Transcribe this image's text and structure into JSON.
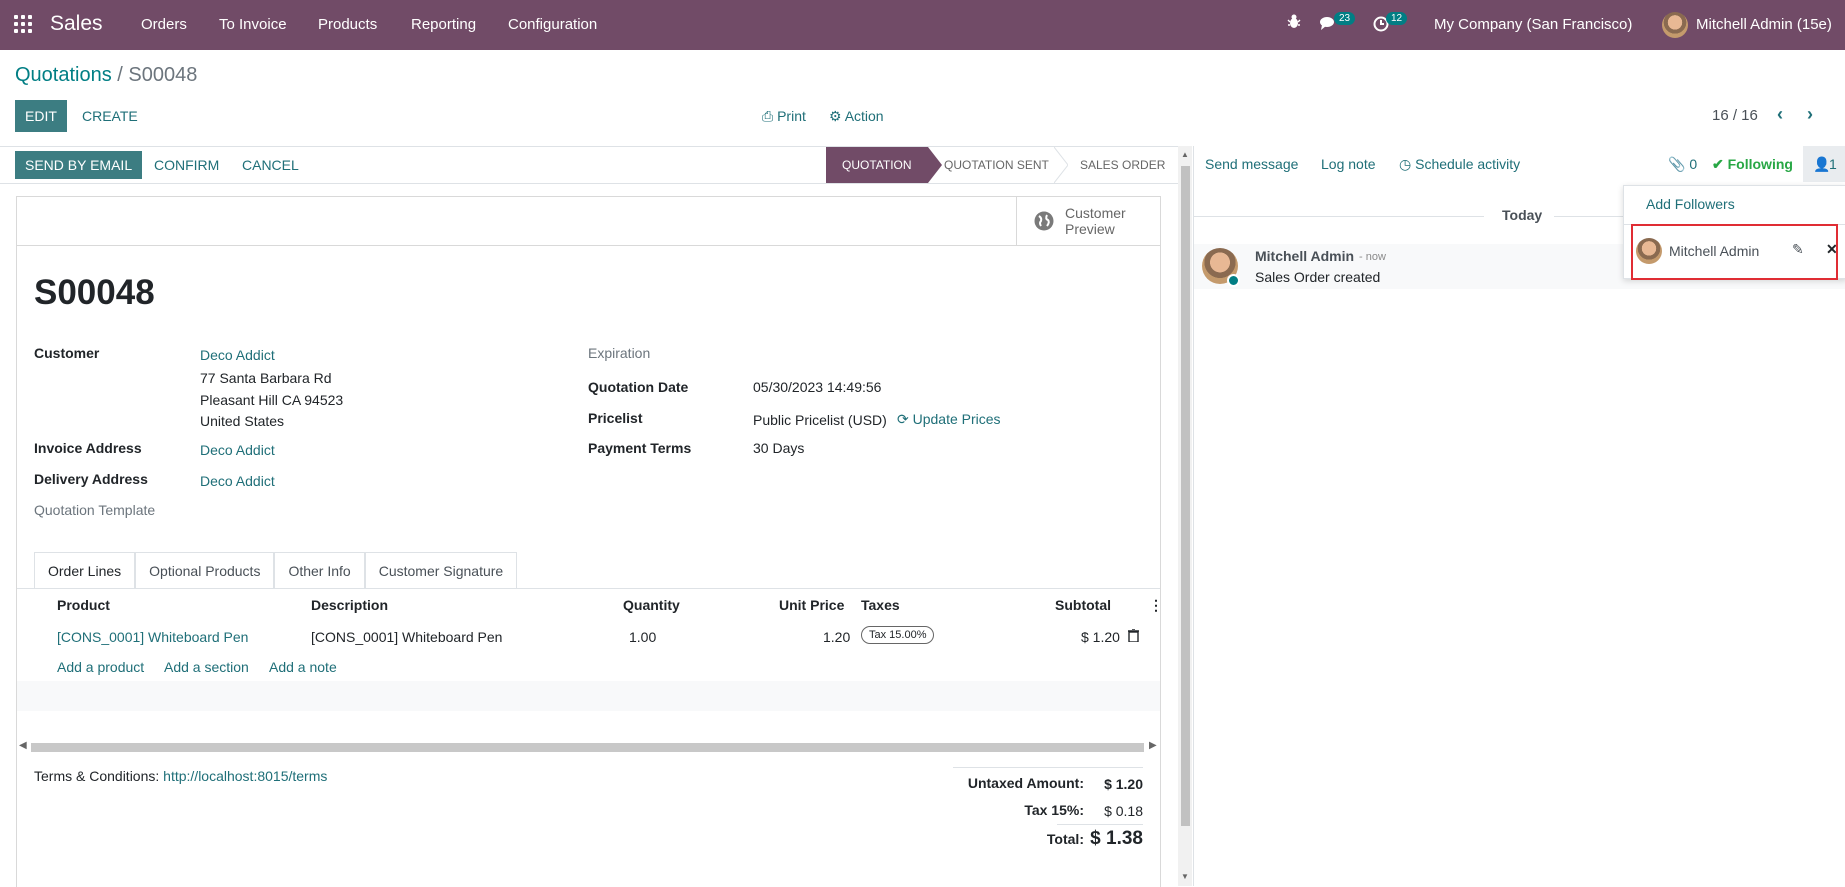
{
  "navbar": {
    "app_name": "Sales",
    "menu": [
      "Orders",
      "To Invoice",
      "Products",
      "Reporting",
      "Configuration"
    ],
    "messages_count": "23",
    "activities_count": "12",
    "company": "My Company (San Francisco)",
    "user": "Mitchell Admin (15e)"
  },
  "breadcrumb": {
    "parent": "Quotations",
    "separator": "/",
    "current": "S00048"
  },
  "controls": {
    "edit": "EDIT",
    "create": "CREATE",
    "print": "Print",
    "action": "Action",
    "pager": "16 / 16"
  },
  "statusbar": {
    "send_email": "SEND BY EMAIL",
    "confirm": "CONFIRM",
    "cancel": "CANCEL",
    "stages": [
      "QUOTATION",
      "QUOTATION SENT",
      "SALES ORDER"
    ]
  },
  "form": {
    "customer_preview": [
      "Customer",
      "Preview"
    ],
    "name": "S00048",
    "customer_label": "Customer",
    "customer_name": "Deco Addict",
    "customer_address": [
      "77 Santa Barbara Rd",
      "Pleasant Hill CA 94523",
      "United States"
    ],
    "invoice_address_label": "Invoice Address",
    "invoice_address": "Deco Addict",
    "delivery_address_label": "Delivery Address",
    "delivery_address": "Deco Addict",
    "quotation_template_label": "Quotation Template",
    "expiration_label": "Expiration",
    "quotation_date_label": "Quotation Date",
    "quotation_date": "05/30/2023 14:49:56",
    "pricelist_label": "Pricelist",
    "pricelist": "Public Pricelist (USD)",
    "update_prices": "Update Prices",
    "payment_terms_label": "Payment Terms",
    "payment_terms": "30 Days"
  },
  "tabs": [
    "Order Lines",
    "Optional Products",
    "Other Info",
    "Customer Signature"
  ],
  "order_lines": {
    "headers": {
      "product": "Product",
      "description": "Description",
      "quantity": "Quantity",
      "unit_price": "Unit Price",
      "taxes": "Taxes",
      "subtotal": "Subtotal"
    },
    "rows": [
      {
        "product": "[CONS_0001] Whiteboard Pen",
        "description": "[CONS_0001] Whiteboard Pen",
        "quantity": "1.00",
        "unit_price": "1.20",
        "taxes": "Tax 15.00%",
        "subtotal": "$ 1.20"
      }
    ],
    "add_product": "Add a product",
    "add_section": "Add a section",
    "add_note": "Add a note"
  },
  "footer": {
    "terms_label": "Terms & Conditions:",
    "terms_link": "http://localhost:8015/terms",
    "untaxed_label": "Untaxed Amount:",
    "untaxed": "$ 1.20",
    "tax_label": "Tax 15%:",
    "tax": "$ 0.18",
    "total_label": "Total:",
    "total": "$ 1.38"
  },
  "chatter": {
    "send_message": "Send message",
    "log_note": "Log note",
    "schedule_activity": "Schedule activity",
    "attachments": "0",
    "following": "Following",
    "followers_count": "1",
    "today": "Today",
    "message": {
      "author": "Mitchell Admin",
      "time": "- now",
      "body": "Sales Order created"
    }
  },
  "followers_dropdown": {
    "add_followers": "Add Followers",
    "follower": "Mitchell Admin"
  },
  "colors": {
    "brand": "#714b67",
    "accent": "#017e84",
    "following": "#28a745",
    "highlight": "#e02d34"
  }
}
